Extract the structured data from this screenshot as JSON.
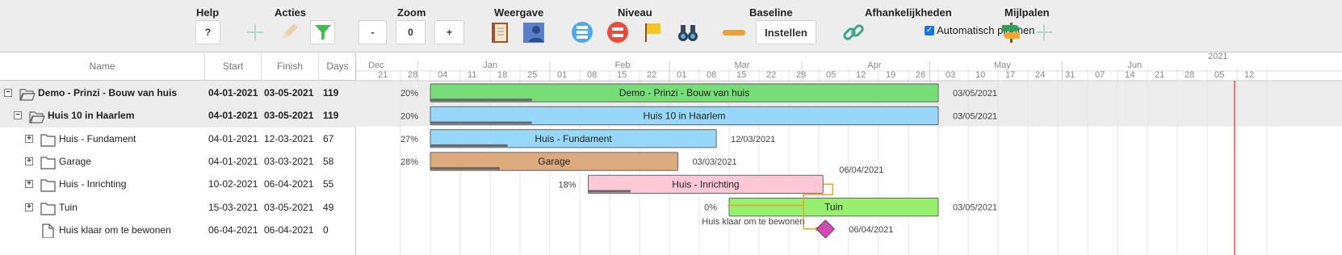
{
  "toolbar": {
    "help": {
      "title": "Help",
      "btn": "?"
    },
    "acties": {
      "title": "Acties"
    },
    "zoom": {
      "title": "Zoom",
      "minus": "-",
      "value": "0",
      "plus": "+"
    },
    "weergave": {
      "title": "Weergave"
    },
    "niveau": {
      "title": "Niveau"
    },
    "baseline": {
      "title": "Baseline",
      "btn": "Instellen"
    },
    "afhankelijkheden": {
      "title": "Afhankelijkheden",
      "checkbox": "Automatisch plannen",
      "checked": true
    },
    "mijlpalen": {
      "title": "Mijlpalen"
    }
  },
  "grid": {
    "headers": {
      "name": "Name",
      "start": "Start",
      "finish": "Finish",
      "days": "Days"
    },
    "rows": [
      {
        "name": "Demo - Prinzi - Bouw van huis",
        "start": "04-01-2021",
        "finish": "03-05-2021",
        "days": "119",
        "toggle": "−",
        "icon": "folder-open-icon"
      },
      {
        "name": "Huis 10 in Haarlem",
        "start": "04-01-2021",
        "finish": "03-05-2021",
        "days": "119",
        "toggle": "−",
        "icon": "folder-open-icon"
      },
      {
        "name": "Huis - Fundament",
        "start": "04-01-2021",
        "finish": "12-03-2021",
        "days": "67",
        "toggle": "+",
        "icon": "folder-icon"
      },
      {
        "name": "Garage",
        "start": "04-01-2021",
        "finish": "03-03-2021",
        "days": "58",
        "toggle": "+",
        "icon": "folder-icon"
      },
      {
        "name": "Huis - Inrichting",
        "start": "10-02-2021",
        "finish": "06-04-2021",
        "days": "55",
        "toggle": "+",
        "icon": "folder-icon"
      },
      {
        "name": "Tuin",
        "start": "15-03-2021",
        "finish": "03-05-2021",
        "days": "49",
        "toggle": "+",
        "icon": "folder-icon"
      },
      {
        "name": "Huis klaar om te bewonen",
        "start": "06-04-2021",
        "finish": "06-04-2021",
        "days": "0",
        "toggle": "",
        "icon": "file-icon"
      }
    ]
  },
  "timeline": {
    "year": "2021",
    "months": [
      "Dec",
      "Jan",
      "Feb",
      "Mar",
      "Apr",
      "May",
      "Jun"
    ],
    "days": [
      "21",
      "28",
      "04",
      "11",
      "18",
      "25",
      "01",
      "08",
      "15",
      "22",
      "01",
      "08",
      "15",
      "22",
      "29",
      "05",
      "12",
      "19",
      "26",
      "03",
      "10",
      "17",
      "24",
      "31",
      "07",
      "14",
      "21",
      "28",
      "05",
      "12"
    ]
  },
  "bars": [
    {
      "name": "Demo - Prinzi - Bouw van huis",
      "percent": "20%",
      "progress": 0.2,
      "end": "03/05/2021",
      "color": "#77dd77"
    },
    {
      "name": "Huis 10 in Haarlem",
      "percent": "20%",
      "progress": 0.2,
      "end": "03/05/2021",
      "color": "#96d7fa"
    },
    {
      "name": "Huis - Fundament",
      "percent": "27%",
      "progress": 0.27,
      "end": "12/03/2021",
      "color": "#96d7fa"
    },
    {
      "name": "Garage",
      "percent": "28%",
      "progress": 0.28,
      "end": "03/03/2021",
      "color": "#dcaa7d"
    },
    {
      "name": "Huis - Inrichting",
      "percent": "18%",
      "progress": 0.18,
      "end": "06/04/2021",
      "color": "#ffc8d7"
    },
    {
      "name": "Tuin",
      "percent": "0%",
      "progress": 0,
      "end": "03/05/2021",
      "color": "#96f06e"
    }
  ],
  "milestone": {
    "name": "Huis klaar om te bewonen",
    "date": "06/04/2021",
    "color": "#d24bb4"
  }
}
